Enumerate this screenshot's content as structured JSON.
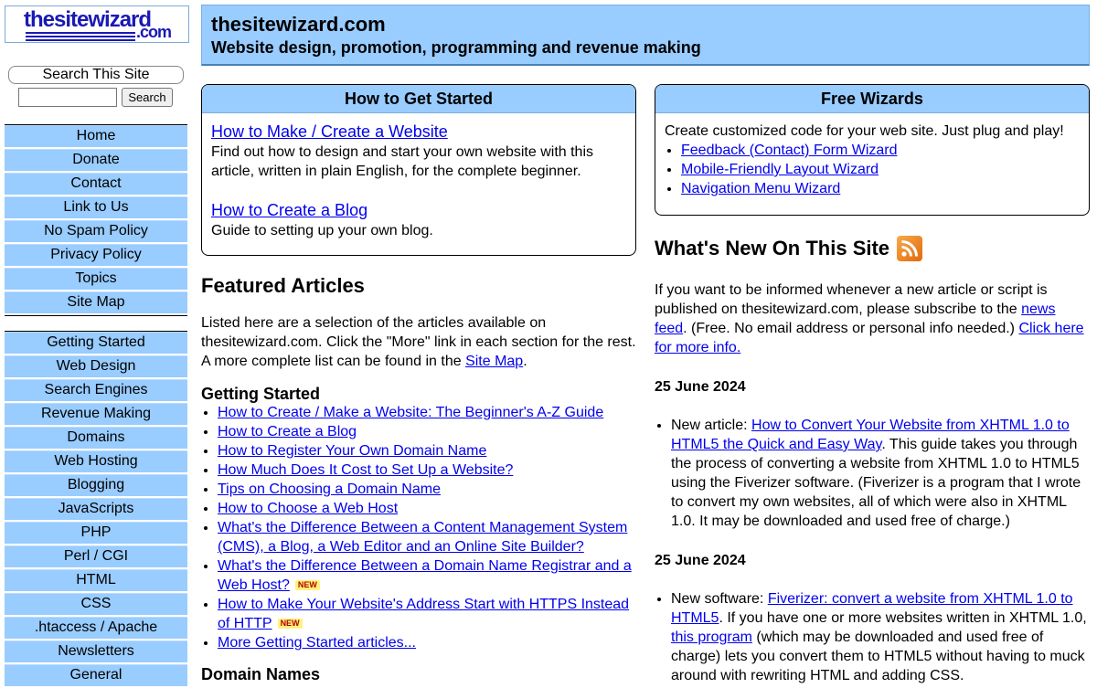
{
  "logo": {
    "main": "thesitewizard",
    "dotcom": ".com"
  },
  "search": {
    "label": "Search This Site",
    "input_value": "",
    "button_label": "Search"
  },
  "nav_primary": [
    "Home",
    "Donate",
    "Contact",
    "Link to Us",
    "No Spam Policy",
    "Privacy Policy",
    "Topics",
    "Site Map"
  ],
  "nav_topics": [
    "Getting Started",
    "Web Design",
    "Search Engines",
    "Revenue Making",
    "Domains",
    "Web Hosting",
    "Blogging",
    "JavaScripts",
    "PHP",
    "Perl / CGI",
    "HTML",
    "CSS",
    ".htaccess / Apache",
    "Newsletters",
    "General"
  ],
  "header": {
    "title": "thesitewizard.com",
    "tagline": "Website design, promotion, programming and revenue making"
  },
  "get_started": {
    "heading": "How to Get Started",
    "link1": "How to Make / Create a Website",
    "text1": "Find out how to design and start your own website with this article, written in plain English, for the complete beginner.",
    "link2": "How to Create a Blog",
    "text2": "Guide to setting up your own blog."
  },
  "wizards": {
    "heading": "Free Wizards",
    "intro": "Create customized code for your web site. Just plug and play!",
    "links": [
      "Feedback (Contact) Form Wizard",
      "Mobile-Friendly Layout Wizard",
      "Navigation Menu Wizard"
    ]
  },
  "featured": {
    "heading": "Featured Articles",
    "intro_before": "Listed here are a selection of the articles available on thesitewizard.com. Click the \"More\" link in each section for the rest. A more complete list can be found in the ",
    "intro_link": "Site Map",
    "intro_after": ".",
    "subheading": "Getting Started",
    "articles": [
      "How to Create / Make a Website: The Beginner's A-Z Guide",
      "How to Create a Blog",
      "How to Register Your Own Domain Name",
      "How Much Does It Cost to Set Up a Website?",
      "Tips on Choosing a Domain Name",
      "How to Choose a Web Host",
      "What's the Difference Between a Content Management System (CMS), a Blog, a Web Editor and an Online Site Builder?",
      "What's the Difference Between a Domain Name Registrar and a Web Host?",
      "How to Make Your Website's Address Start with HTTPS Instead of HTTP",
      "More Getting Started articles..."
    ],
    "new_badge": "NEW",
    "next_subheading": "Domain Names"
  },
  "whats_new": {
    "heading": "What's New On This Site",
    "subscribe_before": "If you want to be informed whenever a new article or script is published on thesitewizard.com, please subscribe to the ",
    "subscribe_link": "news feed",
    "subscribe_middle": ". (Free. No email address or personal info needed.) ",
    "more_info_link": "Click here for more info.",
    "entries": [
      {
        "date": "25 June 2024",
        "prefix": "New article: ",
        "link": "How to Convert Your Website from XHTML 1.0 to HTML5 the Quick and Easy Way",
        "text": ". This guide takes you through the process of converting a website from XHTML 1.0 to HTML5 using the Fiverizer software. (Fiverizer is a program that I wrote to convert my own websites, all of which were also in XHTML 1.0. It may be downloaded and used free of charge.)"
      },
      {
        "date": "25 June 2024",
        "prefix": "New software: ",
        "link": "Fiverizer: convert a website from XHTML 1.0 to HTML5",
        "text_a": ". If you have one or more websites written in XHTML 1.0, ",
        "link2": "this program",
        "text_b": " (which may be downloaded and used free of charge) lets you convert them to HTML5 without having to muck around with rewriting HTML and adding CSS."
      }
    ]
  },
  "colors": {
    "nav_bg": "#99ccff",
    "link": "#0000ee",
    "logo": "#1919b4",
    "rss": "#f28a1e"
  },
  "icons": {
    "rss": "rss-feed-icon"
  }
}
